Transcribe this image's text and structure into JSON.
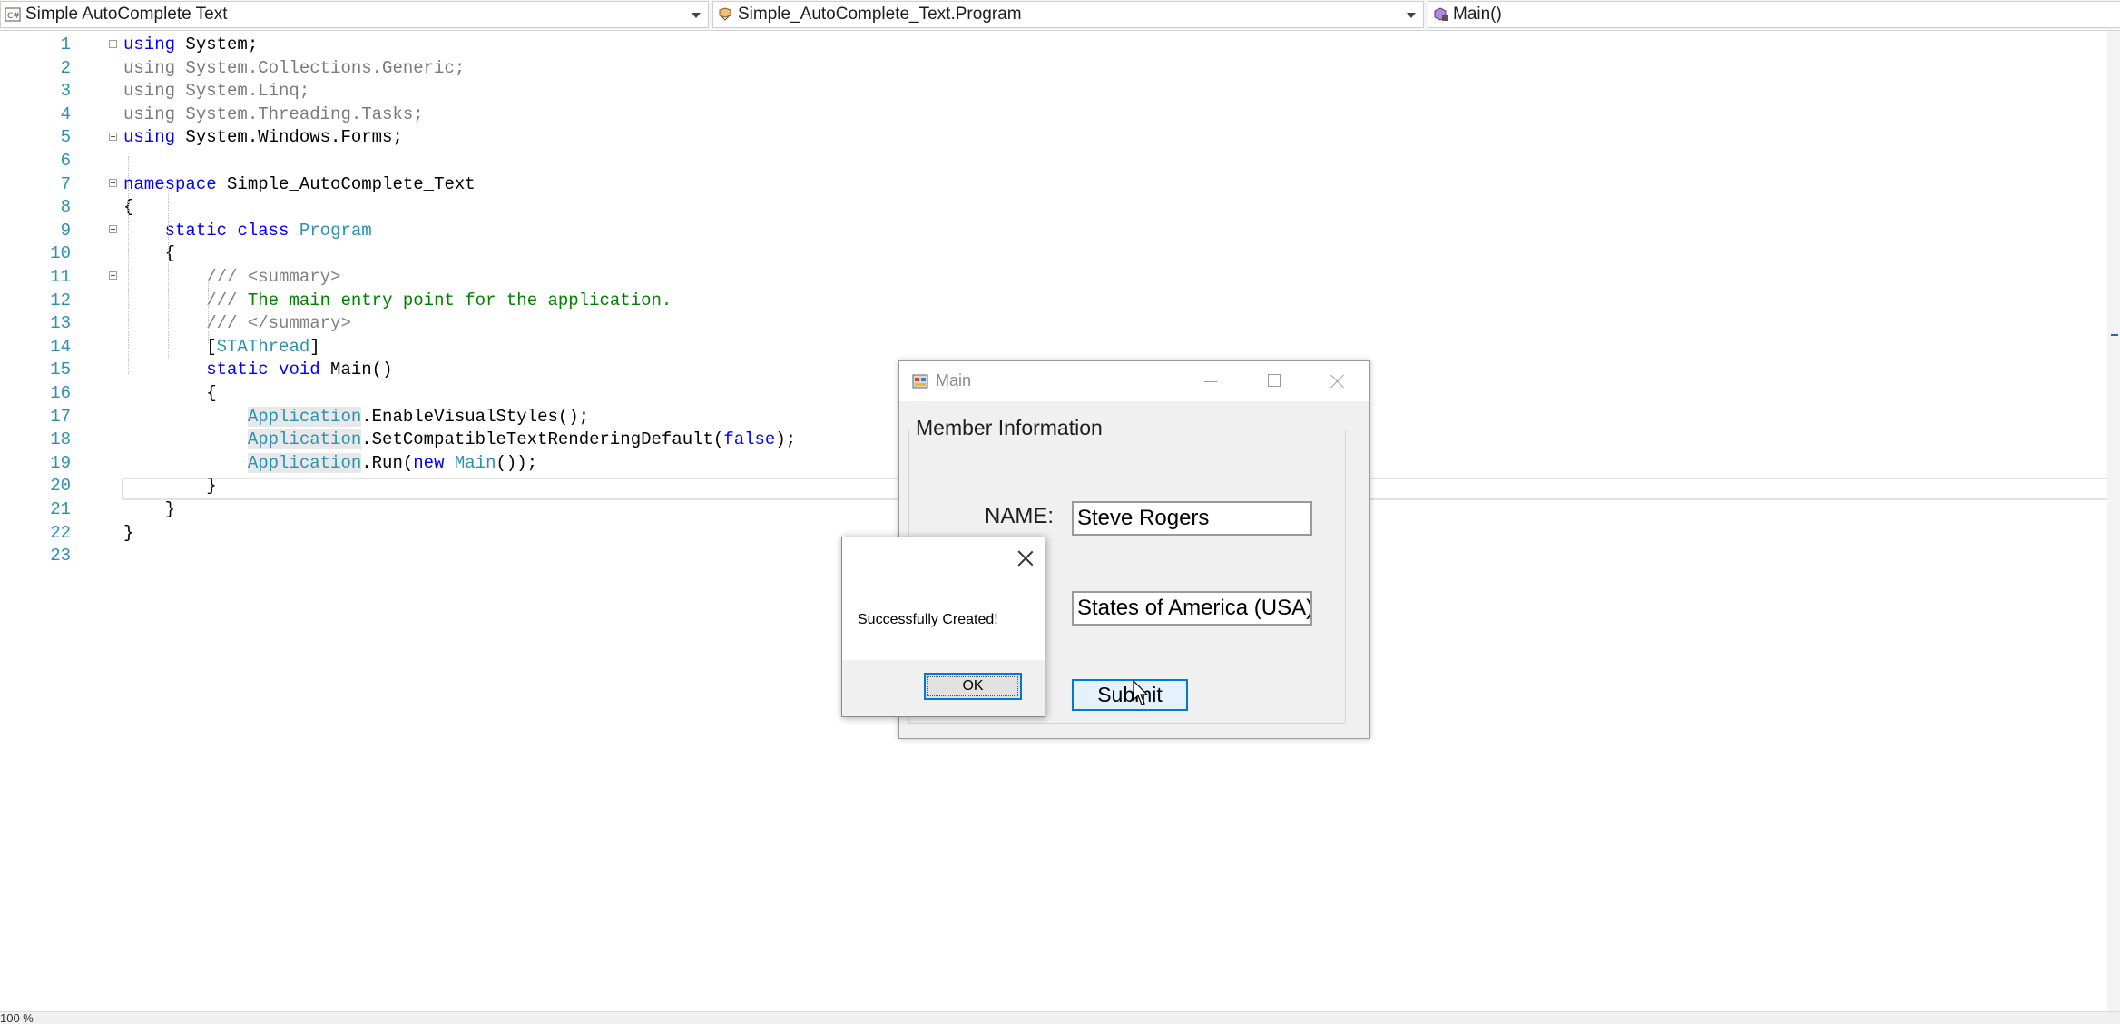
{
  "navbar": {
    "project": "Simple AutoComplete Text",
    "class": "Simple_AutoComplete_Text.Program",
    "member": "Main()",
    "project_icon": "csharp-project-icon",
    "class_icon": "class-icon",
    "member_icon": "method-icon"
  },
  "code_lines": [
    {
      "n": "1",
      "html": "<span class=\"kw\">using</span> System;"
    },
    {
      "n": "2",
      "html": "<span class=\"kwg\">using System.Collections.Generic;</span>"
    },
    {
      "n": "3",
      "html": "<span class=\"kwg\">using System.Linq;</span>"
    },
    {
      "n": "4",
      "html": "<span class=\"kwg\">using System.Threading.Tasks;</span>"
    },
    {
      "n": "5",
      "html": "<span class=\"kw\">using</span> System.Windows.Forms;"
    },
    {
      "n": "6",
      "html": ""
    },
    {
      "n": "7",
      "html": "<span class=\"kw\">namespace</span> Simple_AutoComplete_Text"
    },
    {
      "n": "8",
      "html": "{"
    },
    {
      "n": "9",
      "html": "    <span class=\"kw\">static</span> <span class=\"kw\">class</span> <span class=\"type\">Program</span>"
    },
    {
      "n": "10",
      "html": "    {"
    },
    {
      "n": "11",
      "html": "        <span class=\"cmtg\">/// &lt;summary&gt;</span>"
    },
    {
      "n": "12",
      "html": "        <span class=\"cmtg\">///</span> <span class=\"cmt\">The main entry point for the application.</span>"
    },
    {
      "n": "13",
      "html": "        <span class=\"cmtg\">/// &lt;/summary&gt;</span>"
    },
    {
      "n": "14",
      "html": "        [<span class=\"type\">STAThread</span>]"
    },
    {
      "n": "15",
      "html": "        <span class=\"kw\">static</span> <span class=\"kw\">void</span> Main()"
    },
    {
      "n": "16",
      "html": "        {"
    },
    {
      "n": "17",
      "html": "            <span class=\"type hl\">Application</span>.EnableVisualStyles();"
    },
    {
      "n": "18",
      "html": "            <span class=\"type hl\">Application</span>.SetCompatibleTextRenderingDefault(<span class=\"kw\">false</span>);"
    },
    {
      "n": "19",
      "html": "            <span class=\"type hl\">Application</span>.Run(<span class=\"kw\">new</span> <span class=\"type\">Main</span>());"
    },
    {
      "n": "20",
      "html": "        }"
    },
    {
      "n": "21",
      "html": "    }"
    },
    {
      "n": "22",
      "html": "}"
    },
    {
      "n": "23",
      "html": ""
    }
  ],
  "status": {
    "zoom": "100 %"
  },
  "main_form": {
    "title": "Main",
    "group_title": "Member Information",
    "name_label": "NAME:",
    "name_value": "Steve Rogers",
    "country_value": "States of America (USA)",
    "submit_label": "Submit",
    "app_icon": "form-app-icon"
  },
  "message_box": {
    "message": "Successfully Created!",
    "ok_label": "OK"
  }
}
